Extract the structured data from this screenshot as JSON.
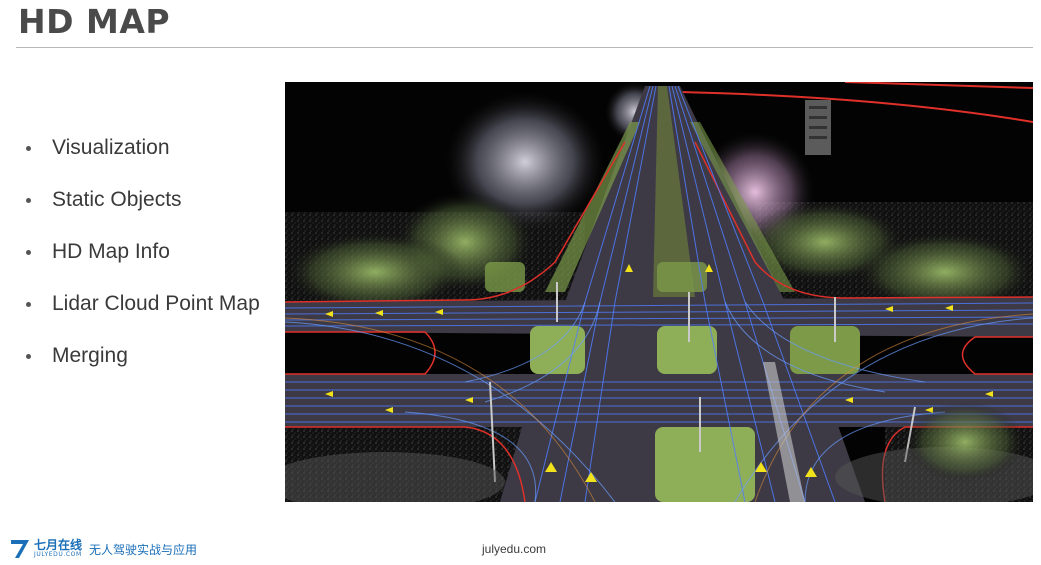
{
  "slide": {
    "title": "HD MAP",
    "bullets": [
      "Visualization",
      "Static Objects",
      "HD Map Info",
      "Lidar Cloud Point Map",
      "Merging"
    ]
  },
  "footer": {
    "logo_cn": "七月在线",
    "logo_en": "JULYEDU.COM",
    "course": "无人驾驶实战与应用",
    "url": "julyedu.com"
  },
  "colors": {
    "title": "#4a4a4a",
    "brand": "#1b6fb8",
    "road": "#3d3a45",
    "lane_blue": "#4f7cff",
    "boundary_red": "#e0302a",
    "arrow_yellow": "#f2e21b",
    "grass": "#8fae58"
  },
  "icons": {
    "logo": "seven-logo-icon",
    "bullet": "bullet-dot-icon"
  }
}
